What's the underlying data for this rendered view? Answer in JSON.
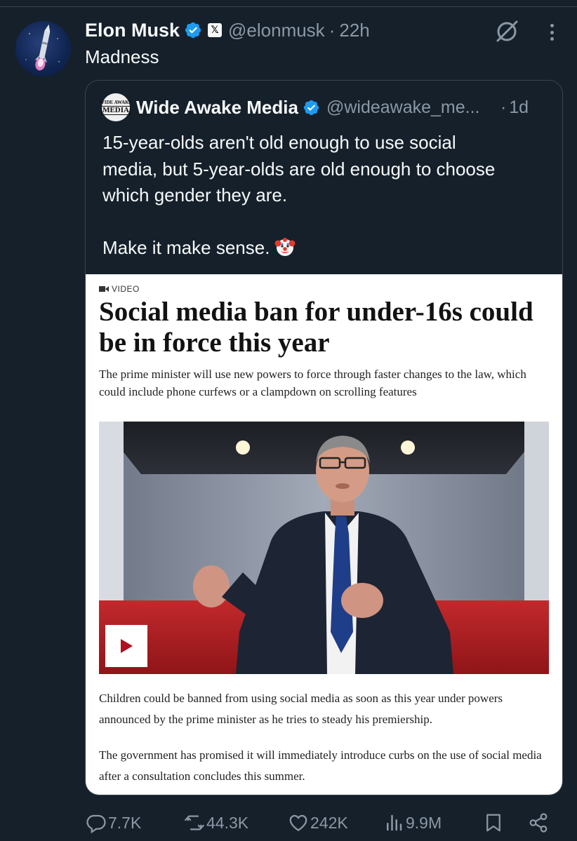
{
  "tweet": {
    "author_name": "Elon Musk",
    "affiliate_badge": "𝕏",
    "handle": "@elonmusk",
    "separator": "·",
    "time": "22h",
    "text": "Madness"
  },
  "quote": {
    "avatar_line1": "WIDE AWAKE",
    "avatar_line2": "MEDIA",
    "author_name": "Wide Awake Media",
    "handle": "@wideawake_me...",
    "separator": "·",
    "time": "1d",
    "lines": [
      "15-year-olds aren't old enough to use social",
      "media, but 5-year-olds are old enough to choose",
      "which gender they are."
    ],
    "closing": "Make it make sense.",
    "emoji": "clown-face"
  },
  "article": {
    "label": "VIDEO",
    "headline": "Social media ban for under-16s could be in force this year",
    "standfirst": "The prime minister will use new powers to force through faster changes to the law, which could include phone curfews or a clampdown on scrolling features",
    "para1": "Children could be banned from using social media as soon as this year under powers announced by the prime minister as he tries to steady his premiership.",
    "para2": "The government has promised it will immediately introduce curbs on the use of social media after a consultation concludes this summer."
  },
  "actions": {
    "replies": "7.7K",
    "reposts": "44.3K",
    "likes": "242K",
    "views": "9.9M"
  },
  "colors": {
    "background": "#15202b",
    "text": "#f7f9f9",
    "muted": "#8b98a5",
    "verified": "#1d9bf0",
    "border": "#38444d"
  }
}
